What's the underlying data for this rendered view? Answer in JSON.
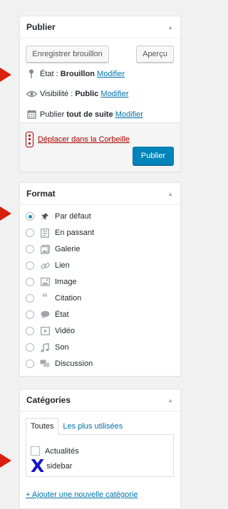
{
  "colors": {
    "arrow": "#d9200f",
    "link": "#0073aa",
    "primary": "#0085ba",
    "danger": "#a00"
  },
  "publish": {
    "title": "Publier",
    "save_draft": "Enregistrer brouillon",
    "preview": "Aperçu",
    "status_label": "État :",
    "status_value": "Brouillon",
    "visibility_label": "Visibilité :",
    "visibility_value": "Public",
    "schedule_label": "Publier",
    "schedule_value": "tout de suite",
    "edit": "Modifier",
    "trash": "Déplacer dans la Corbeille",
    "publish": "Publier"
  },
  "format": {
    "title": "Format",
    "selected": "Par défaut",
    "options": [
      {
        "label": "Par défaut",
        "icon": "pin-icon"
      },
      {
        "label": "En passant",
        "icon": "aside-icon"
      },
      {
        "label": "Galerie",
        "icon": "gallery-icon"
      },
      {
        "label": "Lien",
        "icon": "link-icon"
      },
      {
        "label": "Image",
        "icon": "image-icon"
      },
      {
        "label": "Citation",
        "icon": "quote-icon"
      },
      {
        "label": "État",
        "icon": "status-icon"
      },
      {
        "label": "Vidéo",
        "icon": "video-icon"
      },
      {
        "label": "Son",
        "icon": "audio-icon"
      },
      {
        "label": "Discussion",
        "icon": "chat-icon"
      }
    ]
  },
  "categories": {
    "title": "Catégories",
    "tab_all": "Toutes",
    "tab_popular": "Les plus utilisées",
    "items": [
      {
        "label": "Actualités"
      },
      {
        "label": "sidebar"
      }
    ],
    "add_new": "+ Ajouter une nouvelle catégorie"
  }
}
